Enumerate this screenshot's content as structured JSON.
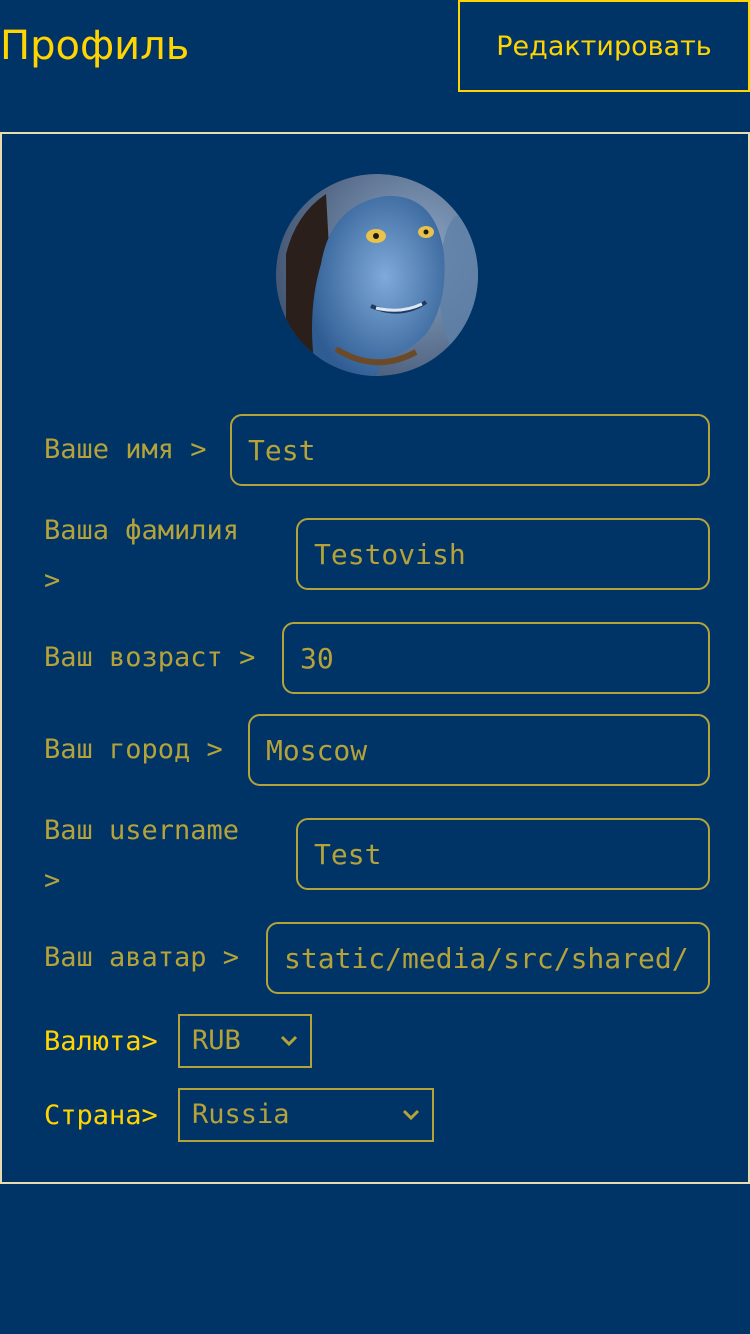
{
  "header": {
    "title": "Профиль",
    "edit_button_label": "Редактировать"
  },
  "profile": {
    "avatar_icon": "avatar-photo",
    "fields": [
      {
        "label": "Ваше имя >",
        "value": "Test"
      },
      {
        "label": "Ваша фамилия >",
        "value": "Testovish"
      },
      {
        "label": "Ваш возраст >",
        "value": "30"
      },
      {
        "label": "Ваш город >",
        "value": "Moscow"
      },
      {
        "label": "Ваш username >",
        "value": "Test"
      },
      {
        "label": "Ваш аватар >",
        "value": "static/media/src/shared/"
      }
    ],
    "currency": {
      "label": "Валюта>",
      "selected": "RUB"
    },
    "country": {
      "label": "Страна>",
      "selected": "Russia"
    }
  },
  "colors": {
    "background": "#003366",
    "accent": "#FFD400",
    "muted_accent": "#B5A33A",
    "card_border": "#E8DCB0"
  }
}
